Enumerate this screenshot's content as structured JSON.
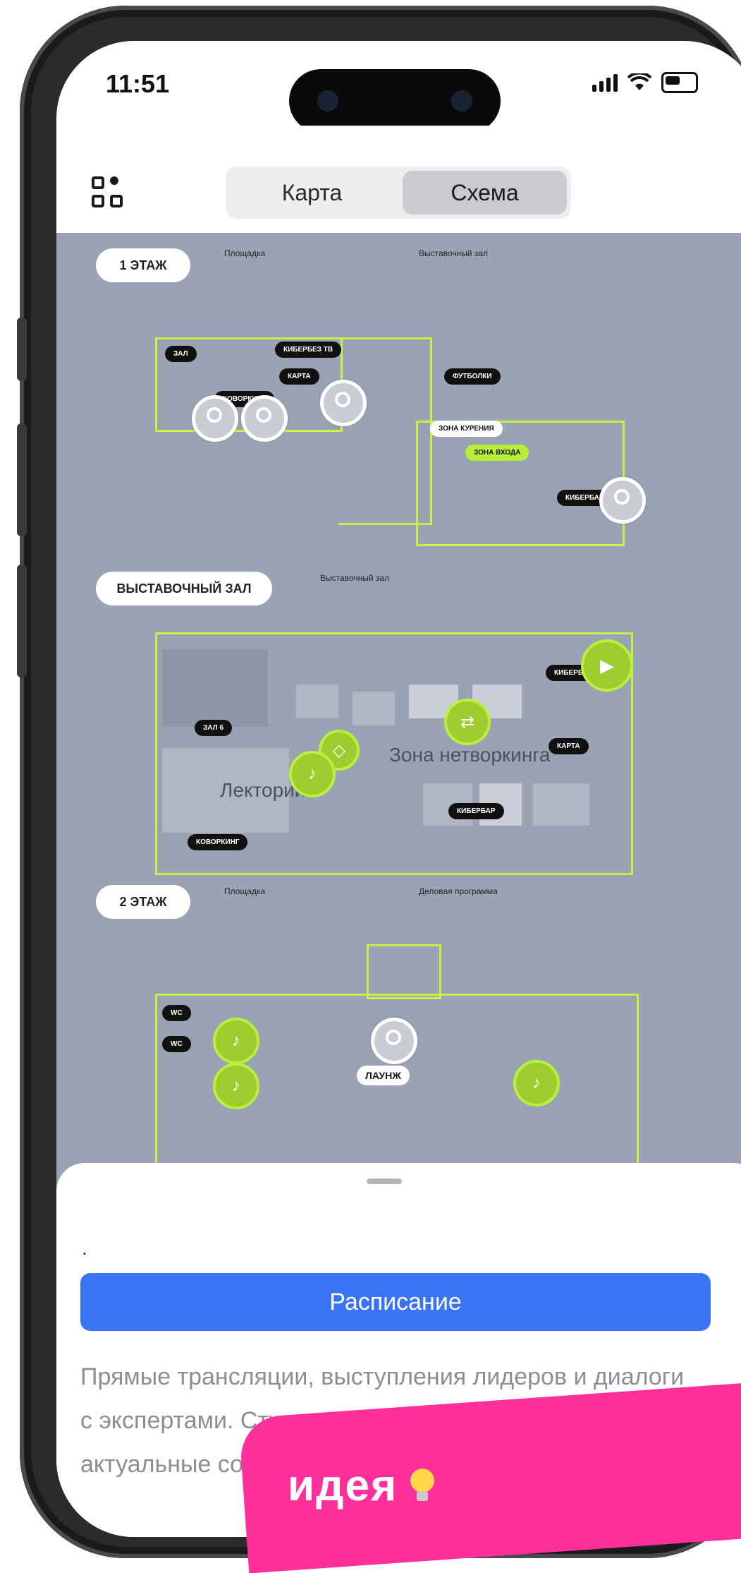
{
  "status": {
    "time": "11:51"
  },
  "header": {
    "tabs": [
      {
        "label": "Карта"
      },
      {
        "label": "Схема"
      }
    ],
    "active_tab": "Схема"
  },
  "map": {
    "floors": [
      {
        "label": "1 ЭТАЖ",
        "legend_left": "Площадка",
        "legend_right": "Выставочный зал"
      },
      {
        "label": "ВЫСТАВОЧНЫЙ ЗАЛ",
        "legend_right": "Выставочный зал"
      },
      {
        "label": "2 ЭТАЖ",
        "legend_left": "Площадка",
        "legend_right": "Деловая программа"
      }
    ],
    "tags": {
      "zal6": "ЗАЛ 6",
      "kiberbeyb": "КИБЕРБЕЗ ТВ",
      "karta": "КАРТА",
      "kovorking": "КОВОРКИНГ",
      "futbolki": "ФУТБОЛКИ",
      "zona_kurenia": "ЗОНА КУРЕНИЯ",
      "zona_vhoda": "ЗОНА ВХОДА",
      "kiberbar": "КИБЕРБАР",
      "zal_cab": "ЗАЛ",
      "launzh": "ЛАУНЖ",
      "wc": "WC",
      "kiberbez_short": "КИБЕРБЕЗ"
    },
    "zones": {
      "networking": "Зона нетворкинга",
      "lectory": "Лекторий"
    }
  },
  "sheet": {
    "dot": ".",
    "button": "Расписание",
    "description": "Прямые трансляции, выступления лидеров и диалоги с экспертами. Студия Кибербез ТВ покажет актуальные события"
  },
  "badge": {
    "label": "идея"
  },
  "colors": {
    "accent_blue": "#3b74f3",
    "map_bg": "#9aa3b4",
    "lime": "#b7ee38",
    "badge_pink": "#ff2f9c"
  }
}
